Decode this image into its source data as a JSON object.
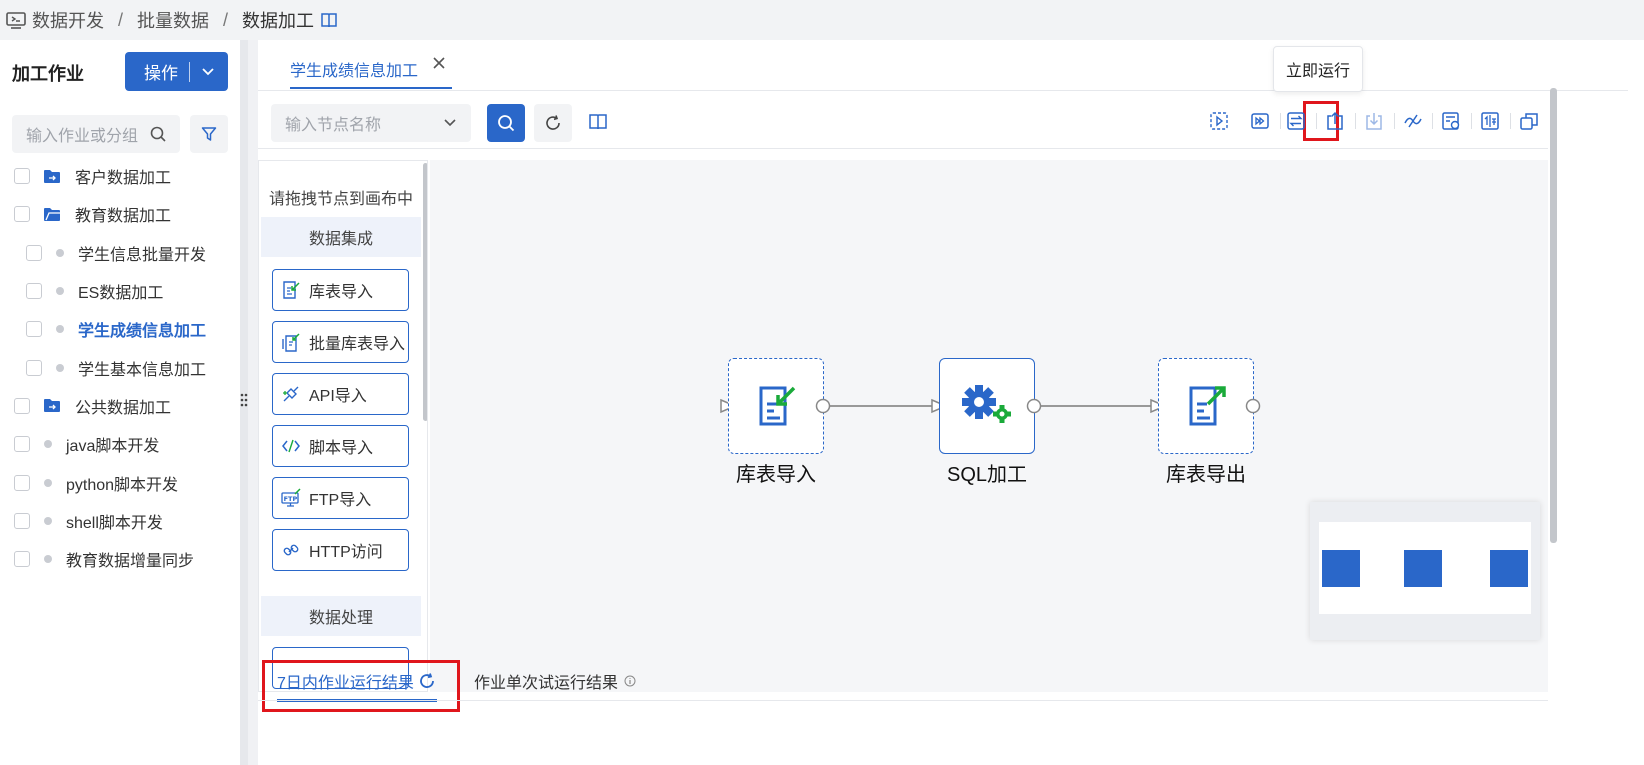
{
  "breadcrumb": {
    "items": [
      "数据开发",
      "批量数据",
      "数据加工"
    ],
    "separator": "/"
  },
  "sidebar": {
    "title": "加工作业",
    "operate_button": "操作",
    "search_placeholder": "输入作业或分组",
    "items": [
      {
        "label": "客户数据加工",
        "type": "folder"
      },
      {
        "label": "教育数据加工",
        "type": "folder-open"
      },
      {
        "label": "学生信息批量开发",
        "type": "job"
      },
      {
        "label": "ES数据加工",
        "type": "job"
      },
      {
        "label": "学生成绩信息加工",
        "type": "job",
        "active": true
      },
      {
        "label": "学生基本信息加工",
        "type": "job"
      },
      {
        "label": "公共数据加工",
        "type": "folder"
      },
      {
        "label": "java脚本开发",
        "type": "job"
      },
      {
        "label": "python脚本开发",
        "type": "job"
      },
      {
        "label": "shell脚本开发",
        "type": "job"
      },
      {
        "label": "教育数据增量同步",
        "type": "job"
      }
    ]
  },
  "editor": {
    "tab_title": "学生成绩信息加工",
    "node_search_placeholder": "输入节点名称",
    "tooltip": "立即运行",
    "toolbar_icons": [
      "debug-run-icon",
      "run-now-icon",
      "switch-icon",
      "upload-icon",
      "download-icon",
      "publish-icon",
      "schedule-icon",
      "compare-icon",
      "copy-icon"
    ]
  },
  "palette": {
    "hint": "请拖拽节点到画布中",
    "group1": "数据集成",
    "items": [
      "库表导入",
      "批量库表导入",
      "API导入",
      "脚本导入",
      "FTP导入",
      "HTTP访问"
    ],
    "group2": "数据处理"
  },
  "flow": {
    "nodes": [
      {
        "label": "库表导入",
        "icon": "table-import-icon"
      },
      {
        "label": "SQL加工",
        "icon": "sql-gear-icon"
      },
      {
        "label": "库表导出",
        "icon": "table-export-icon"
      }
    ]
  },
  "bottom_tabs": {
    "run_results_7d": "7日内作业运行结果",
    "single_test_results": "作业单次试运行结果"
  },
  "colors": {
    "accent": "#2a67c9",
    "highlight": "#e0161c",
    "success": "#1aaa3a"
  }
}
